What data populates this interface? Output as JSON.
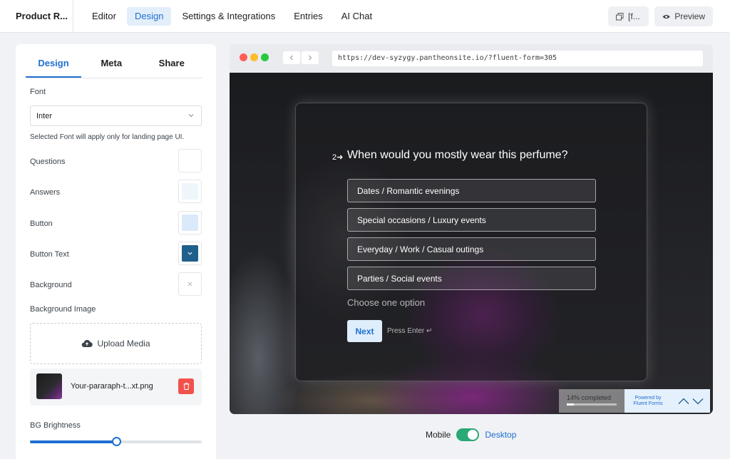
{
  "header": {
    "app_title": "Product R...",
    "tabs": [
      {
        "label": "Editor"
      },
      {
        "label": "Design"
      },
      {
        "label": "Settings & Integrations"
      },
      {
        "label": "Entries"
      },
      {
        "label": "AI Chat"
      }
    ],
    "active_tab": "Design",
    "shortcode_label": "[f...",
    "preview_label": "Preview"
  },
  "panel": {
    "tabs": [
      {
        "label": "Design"
      },
      {
        "label": "Meta"
      },
      {
        "label": "Share"
      }
    ],
    "font_label": "Font",
    "font_value": "Inter",
    "font_note": "Selected Font will apply only for landing page UI.",
    "colors": [
      {
        "label": "Questions",
        "color": "#ffffff",
        "icon": ""
      },
      {
        "label": "Answers",
        "color": "#eef6fc",
        "icon": ""
      },
      {
        "label": "Button",
        "color": "#dbeafb",
        "icon": ""
      },
      {
        "label": "Button Text",
        "color": "#1f5f8b",
        "icon": "chevron-down-icon"
      },
      {
        "label": "Background",
        "color": "#ffffff",
        "icon": "close-icon"
      }
    ],
    "bg_image_label": "Background Image",
    "upload_label": "Upload Media",
    "file_name": "Your-pararaph-t...xt.png",
    "brightness_label": "BG Brightness",
    "brightness_value": 0.5
  },
  "browser": {
    "url": "https://dev-syzygy.pantheonsite.io/?fluent-form=305",
    "dot_colors": [
      "#ff5f57",
      "#febc2e",
      "#28c840"
    ]
  },
  "form": {
    "question_number": "2",
    "question": "When would you mostly wear this perfume?",
    "options": [
      "Dates / Romantic evenings",
      "Special occasions / Luxury events",
      "Everyday / Work / Casual outings",
      "Parties / Social events"
    ],
    "hint": "Choose one option",
    "next_label": "Next",
    "press_enter": "Press Enter ↵",
    "progress_text": "14% completed",
    "progress_value": 0.14,
    "powered_line1": "Powered by",
    "powered_line2": "Fluent Forms"
  },
  "footer": {
    "mobile_label": "Mobile",
    "desktop_label": "Desktop",
    "toggle_on": true
  }
}
